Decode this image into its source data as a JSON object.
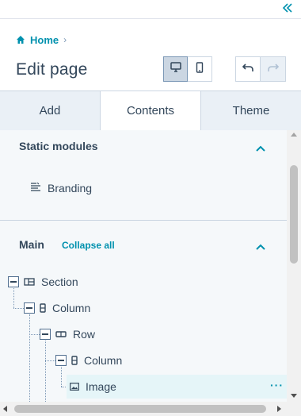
{
  "header": {
    "collapse_icon": "double-chevron-left-icon",
    "breadcrumb": {
      "home_icon": "home-icon",
      "label": "Home",
      "separator": "›"
    },
    "title": "Edit page",
    "device_toggle": {
      "desktop_icon": "desktop-icon",
      "mobile_icon": "mobile-icon",
      "selected": "desktop"
    },
    "history": {
      "undo_icon": "undo-icon",
      "redo_icon": "redo-icon",
      "redo_enabled": false
    }
  },
  "tabs": [
    {
      "label": "Add"
    },
    {
      "label": "Contents",
      "active": true
    },
    {
      "label": "Theme"
    }
  ],
  "static_modules": {
    "heading": "Static modules",
    "items": [
      {
        "icon": "text-align-icon",
        "label": "Branding"
      }
    ]
  },
  "main": {
    "heading": "Main",
    "collapse_all": "Collapse all",
    "tree": [
      {
        "label": "Section",
        "icon": "section-icon",
        "depth": 0,
        "expanded": true
      },
      {
        "label": "Column",
        "icon": "column-icon",
        "depth": 1,
        "expanded": true
      },
      {
        "label": "Row",
        "icon": "row-icon",
        "depth": 2,
        "expanded": true
      },
      {
        "label": "Column",
        "icon": "column-icon",
        "depth": 3,
        "expanded": true
      },
      {
        "label": "Image",
        "icon": "image-icon",
        "depth": 4,
        "selected": true,
        "more": "···"
      }
    ]
  },
  "colors": {
    "accent": "#0091ae",
    "text": "#33475b",
    "panel_bg": "#f5f8fa",
    "tab_bg": "#eaf0f6",
    "border": "#cbd6e2",
    "selected_row": "#e5f5f8"
  }
}
